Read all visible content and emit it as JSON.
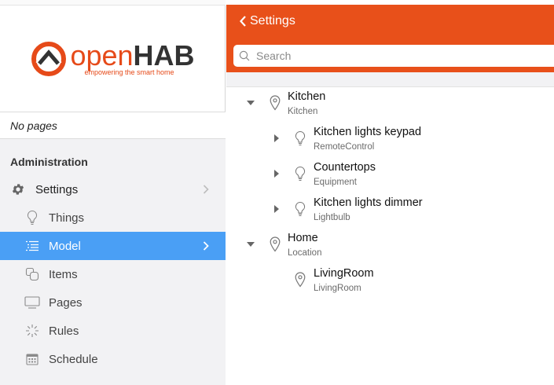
{
  "colors": {
    "header": "#e8501a",
    "active": "#4a9ff5",
    "logo_orange": "#e64a19"
  },
  "logo": {
    "open": "open",
    "hab": "HAB",
    "tagline": "empowering the smart home"
  },
  "sidebar": {
    "no_pages": "No pages",
    "admin_title": "Administration",
    "items": [
      {
        "label": "Settings",
        "icon": "gear-icon"
      },
      {
        "label": "Things",
        "icon": "lightbulb-icon"
      },
      {
        "label": "Model",
        "icon": "list-icon",
        "active": true
      },
      {
        "label": "Items",
        "icon": "items-icon"
      },
      {
        "label": "Pages",
        "icon": "monitor-icon"
      },
      {
        "label": "Rules",
        "icon": "spinner-icon"
      },
      {
        "label": "Schedule",
        "icon": "calendar-icon"
      }
    ]
  },
  "header": {
    "back_label": "Settings",
    "search_placeholder": "Search"
  },
  "tree": [
    {
      "title": "Kitchen",
      "subtitle": "Kitchen",
      "icon": "location-pin-icon",
      "expanded": true,
      "level": 0
    },
    {
      "title": "Kitchen lights keypad",
      "subtitle": "RemoteControl",
      "icon": "lightbulb-icon",
      "expanded": false,
      "level": 1
    },
    {
      "title": "Countertops",
      "subtitle": "Equipment",
      "icon": "lightbulb-icon",
      "expanded": false,
      "level": 1
    },
    {
      "title": "Kitchen lights dimmer",
      "subtitle": "Lightbulb",
      "icon": "lightbulb-icon",
      "expanded": false,
      "level": 1
    },
    {
      "title": "Home",
      "subtitle": "Location",
      "icon": "location-pin-icon",
      "expanded": true,
      "level": 0
    },
    {
      "title": "LivingRoom",
      "subtitle": "LivingRoom",
      "icon": "location-pin-icon",
      "level": 1
    }
  ]
}
